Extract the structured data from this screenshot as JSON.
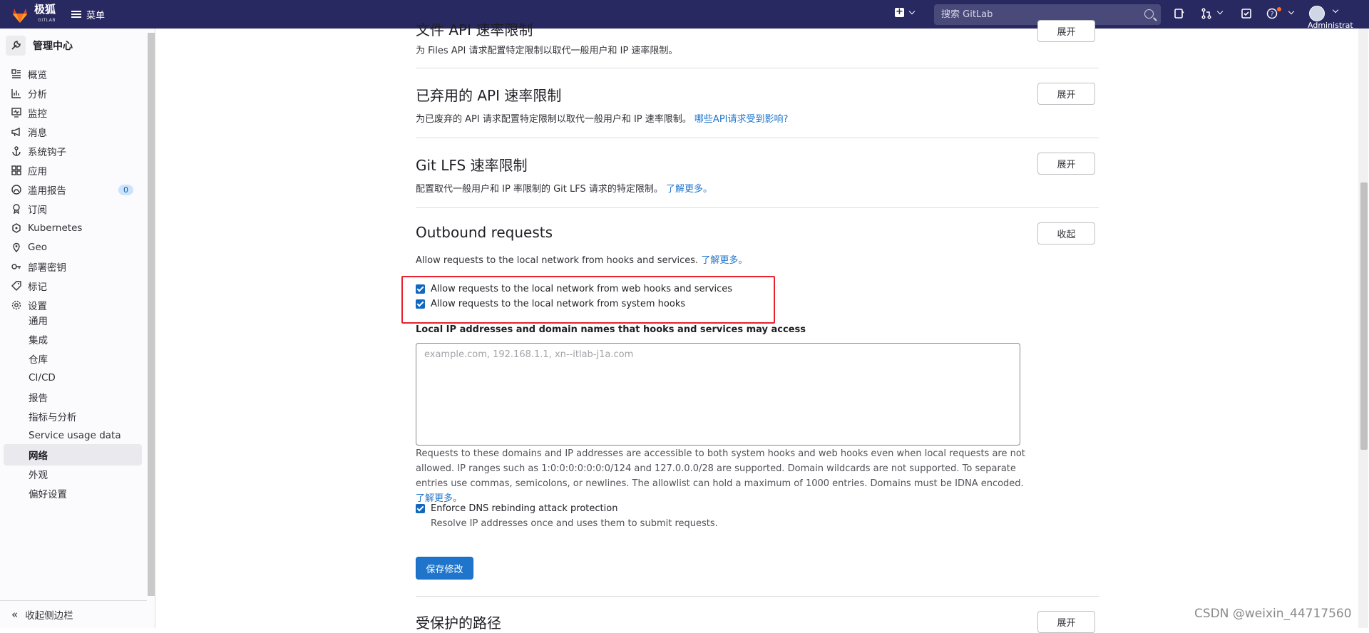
{
  "topbar": {
    "brand": "极狐",
    "brand_sub": "GITLAB",
    "menu_label": "菜单",
    "search_placeholder": "搜索 GitLab",
    "user_label": "Administrat"
  },
  "sidebar": {
    "header": "管理中心",
    "items": [
      {
        "label": "概览",
        "icon": "overview-icon"
      },
      {
        "label": "分析",
        "icon": "analytics-icon"
      },
      {
        "label": "监控",
        "icon": "monitor-icon"
      },
      {
        "label": "消息",
        "icon": "messages-icon"
      },
      {
        "label": "系统钩子",
        "icon": "hook-icon"
      },
      {
        "label": "应用",
        "icon": "applications-icon"
      },
      {
        "label": "滥用报告",
        "icon": "abuse-report-icon",
        "badge": "0"
      },
      {
        "label": "订阅",
        "icon": "subscription-icon"
      },
      {
        "label": "Kubernetes",
        "icon": "kubernetes-icon"
      },
      {
        "label": "Geo",
        "icon": "geo-icon"
      },
      {
        "label": "部署密钥",
        "icon": "key-icon"
      },
      {
        "label": "标记",
        "icon": "label-icon"
      },
      {
        "label": "设置",
        "icon": "settings-icon"
      }
    ],
    "sub_items": [
      "通用",
      "集成",
      "仓库",
      "CI/CD",
      "报告",
      "指标与分析",
      "Service usage data",
      "网络",
      "外观",
      "偏好设置"
    ],
    "active_sub": "网络",
    "collapse_label": "收起侧边栏"
  },
  "sections": {
    "files_api": {
      "title": "文件 API 速率限制",
      "desc": "为 Files API 请求配置特定限制以取代一般用户和 IP 速率限制。",
      "button": "展开"
    },
    "deprecated_api": {
      "title": "已弃用的 API 速率限制",
      "desc": "为已废弃的 API 请求配置特定限制以取代一般用户和 IP 速率限制。",
      "link": "哪些API请求受到影响?",
      "button": "展开"
    },
    "git_lfs": {
      "title": "Git LFS 速率限制",
      "desc": "配置取代一般用户和 IP 率限制的 Git LFS 请求的特定限制。",
      "link": "了解更多。",
      "button": "展开"
    },
    "outbound": {
      "title": "Outbound requests",
      "desc": "Allow requests to the local network from hooks and services.",
      "link": "了解更多。",
      "button": "收起",
      "checkbox_web_hooks": "Allow requests to the local network from web hooks and services",
      "checkbox_system_hooks": "Allow requests to the local network from system hooks",
      "field_label": "Local IP addresses and domain names that hooks and services may access",
      "textarea_placeholder": "example.com, 192.168.1.1, xn--itlab-j1a.com",
      "help_text": "Requests to these domains and IP addresses are accessible to both system hooks and web hooks even when local requests are not allowed. IP ranges such as 1:0:0:0:0:0:0:0/124 and 127.0.0.0/28 are supported. Domain wildcards are not supported. To separate entries use commas, semicolons, or newlines. The allowlist can hold a maximum of 1000 entries. Domains must be IDNA encoded.",
      "help_link": "了解更多。",
      "dns_label": "Enforce DNS rebinding attack protection",
      "dns_help": "Resolve IP addresses once and uses them to submit requests.",
      "save_button": "保存修改"
    },
    "protected_paths": {
      "title": "受保护的路径",
      "button": "展开"
    }
  },
  "watermark": "CSDN @weixin_44717560",
  "colors": {
    "navbar": "#292961",
    "primary": "#1f75cb",
    "highlight_box": "#e8212d"
  }
}
